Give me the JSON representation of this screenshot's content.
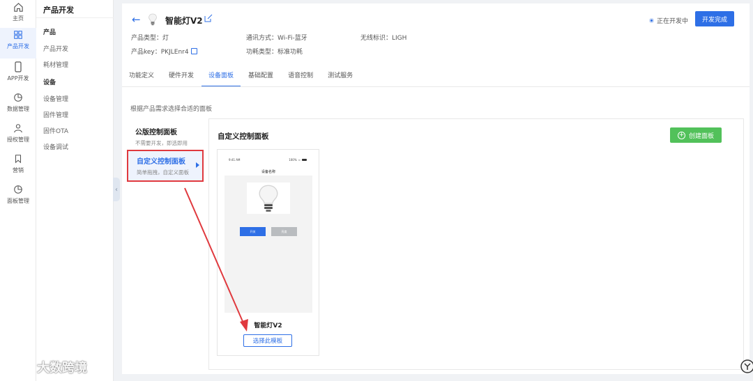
{
  "rail": {
    "items": [
      {
        "label": "主页",
        "icon": "home-icon"
      },
      {
        "label": "产品开发",
        "icon": "grid-icon",
        "active": true
      },
      {
        "label": "APP开发",
        "icon": "phone-icon"
      },
      {
        "label": "数据管理",
        "icon": "pie-chart-icon"
      },
      {
        "label": "授权管理",
        "icon": "user-icon"
      },
      {
        "label": "营销",
        "icon": "bookmark-icon"
      },
      {
        "label": "面板管理",
        "icon": "pie-chart-icon"
      }
    ]
  },
  "subnav": {
    "title": "产品开发",
    "groups": [
      {
        "label": "产品",
        "items": [
          "产品开发",
          "耗材管理"
        ]
      },
      {
        "label": "设备",
        "items": [
          "设备管理",
          "固件管理",
          "固件OTA",
          "设备调试"
        ]
      }
    ]
  },
  "header": {
    "title": "智能灯V2",
    "status": "正在开发中",
    "done_button": "开发完成",
    "meta": {
      "product_type": "产品类型：灯",
      "comm_mode": "通讯方式：Wi-Fi-蓝牙",
      "wireless_id": "无线标识：LIGH",
      "product_key": "产品key：PKJLEnr4",
      "power_type": "功耗类型：标准功耗"
    }
  },
  "tabs": [
    "功能定义",
    "硬件开发",
    "设备面板",
    "基础配置",
    "语音控制",
    "测试服务"
  ],
  "active_tab": "设备面板",
  "hint": "根据产品需求选择合适的面板",
  "panel_types": [
    {
      "title": "公版控制面板",
      "subtitle": "不需要开发，即选即用"
    },
    {
      "title": "自定义控制面板",
      "subtitle": "简单拖拽，自定义面板",
      "active": true
    }
  ],
  "content": {
    "title": "自定义控制面板",
    "create_button": "创建面板",
    "template": {
      "phone_time": "9:41 AM",
      "phone_battery": "100%",
      "device_name": "设备名称",
      "on_label": "开关",
      "off_label": "亮度",
      "name": "智能灯V2",
      "select_button": "选择此模板"
    }
  },
  "watermark": "大数跨境",
  "colors": {
    "accent": "#2e6fe6",
    "green": "#52c15a",
    "highlight_red": "#e0393e"
  }
}
